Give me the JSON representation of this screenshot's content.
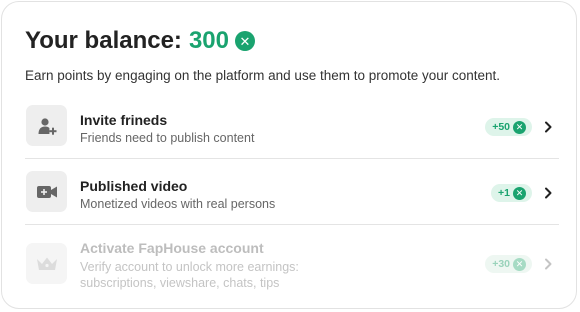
{
  "balance": {
    "label": "Your balance:",
    "amount": "300"
  },
  "subtitle": "Earn points by engaging on the platform and use them to promote your content.",
  "tasks": [
    {
      "title": "Invite frineds",
      "description": "Friends need to publish content",
      "reward": "+50",
      "icon": "add-user-icon",
      "enabled": true
    },
    {
      "title": "Published video",
      "description": "Monetized videos with real persons",
      "reward": "+1",
      "icon": "video-camera-plus-icon",
      "enabled": true
    },
    {
      "title": "Activate FapHouse account",
      "description_line1": "Verify account to unlock more earnings:",
      "description_line2": "subscriptions, viewshare, chats, tips",
      "reward": "+30",
      "icon": "crown-icon",
      "enabled": false
    }
  ],
  "colors": {
    "accent": "#1aa36f",
    "badge_bg": "#def4ea",
    "text_primary": "#222222",
    "text_secondary": "#666666",
    "disabled_text": "#bdbdbd"
  }
}
